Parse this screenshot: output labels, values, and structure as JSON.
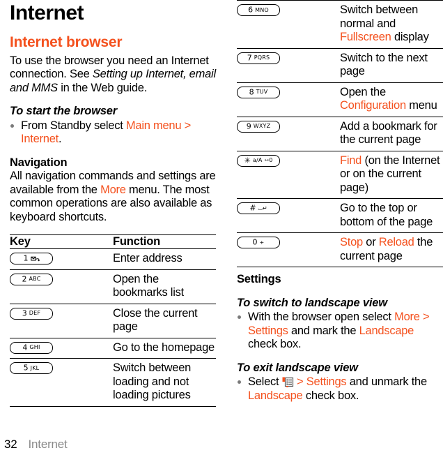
{
  "colors": {
    "accent": "#F4511E",
    "text": "#000000",
    "footer_gray": "#8a8a8a"
  },
  "document": {
    "title": "Internet",
    "section_title": "Internet browser"
  },
  "intro": {
    "p1_a": "To use the browser you need an Internet connection. See ",
    "p1_italic": "Setting up Internet, email and MMS",
    "p1_b": " in the Web guide."
  },
  "start_browser": {
    "heading": "To start the browser",
    "bullet_a": "From Standby select ",
    "bullet_link": "Main menu > Internet",
    "bullet_b": "."
  },
  "navigation": {
    "heading": "Navigation",
    "text_a": "All navigation commands and settings are available from the ",
    "link": "More",
    "text_b": " menu. The most common operations are also available as keyboard shortcuts."
  },
  "table": {
    "header": {
      "key": "Key",
      "function": "Function"
    },
    "rows_left": [
      {
        "key": {
          "num": "1",
          "letters": "",
          "glyph": "voicemail-icon"
        },
        "fn_parts": [
          {
            "t": "Enter address",
            "c": "plain"
          }
        ]
      },
      {
        "key": {
          "num": "2",
          "letters": "ABC",
          "glyph": ""
        },
        "fn_parts": [
          {
            "t": "Open the bookmarks list",
            "c": "plain"
          }
        ]
      },
      {
        "key": {
          "num": "3",
          "letters": "DEF",
          "glyph": ""
        },
        "fn_parts": [
          {
            "t": "Close the current page",
            "c": "plain"
          }
        ]
      },
      {
        "key": {
          "num": "4",
          "letters": "GHI",
          "glyph": ""
        },
        "fn_parts": [
          {
            "t": "Go to the homepage",
            "c": "plain"
          }
        ]
      },
      {
        "key": {
          "num": "5",
          "letters": "JKL",
          "glyph": ""
        },
        "fn_parts": [
          {
            "t": "Switch between loading and not loading pictures",
            "c": "plain"
          }
        ]
      }
    ],
    "rows_right": [
      {
        "key": {
          "num": "6",
          "letters": "MNO",
          "glyph": ""
        },
        "fn_parts": [
          {
            "t": "Switch between normal and ",
            "c": "plain"
          },
          {
            "t": "Fullscreen",
            "c": "accent"
          },
          {
            "t": " display",
            "c": "plain"
          }
        ]
      },
      {
        "key": {
          "num": "7",
          "letters": "PQRS",
          "glyph": ""
        },
        "fn_parts": [
          {
            "t": "Switch to the next page",
            "c": "plain"
          }
        ]
      },
      {
        "key": {
          "num": "8",
          "letters": "TUV",
          "glyph": ""
        },
        "fn_parts": [
          {
            "t": "Open the ",
            "c": "plain"
          },
          {
            "t": "Configuration",
            "c": "accent"
          },
          {
            "t": " menu",
            "c": "plain"
          }
        ]
      },
      {
        "key": {
          "num": "9",
          "letters": "WXYZ",
          "glyph": ""
        },
        "fn_parts": [
          {
            "t": "Add a bookmark for the current page",
            "c": "plain"
          }
        ]
      },
      {
        "key": {
          "num": "✳",
          "letters": "a/A",
          "glyph": "⇿0"
        },
        "fn_parts": [
          {
            "t": "Find",
            "c": "accent"
          },
          {
            "t": " (on the Internet or on the current page)",
            "c": "plain"
          }
        ]
      },
      {
        "key": {
          "num": "#",
          "letters": "",
          "glyph": "⌴↵"
        },
        "fn_parts": [
          {
            "t": "Go to the top or bottom of the page",
            "c": "plain"
          }
        ]
      },
      {
        "key": {
          "num": "0",
          "letters": "+",
          "glyph": ""
        },
        "fn_parts": [
          {
            "t": "Stop",
            "c": "accent"
          },
          {
            "t": " or ",
            "c": "plain"
          },
          {
            "t": "Reload",
            "c": "accent"
          },
          {
            "t": " the current page",
            "c": "plain"
          }
        ]
      }
    ]
  },
  "settings": {
    "heading": "Settings",
    "landscape_on": {
      "heading": "To switch to landscape view",
      "a": "With the browser open select ",
      "link1": "More > Settings",
      "b": " and mark the ",
      "link2": "Landscape",
      "c": " check box."
    },
    "landscape_off": {
      "heading": "To exit landscape view",
      "a": "Select ",
      "icon": "more-menu-icon",
      "link1": " > Settings",
      "b": " and unmark the ",
      "link2": "Landscape",
      "c": " check box."
    }
  },
  "footer": {
    "page_number": "32",
    "page_name": "Internet"
  }
}
